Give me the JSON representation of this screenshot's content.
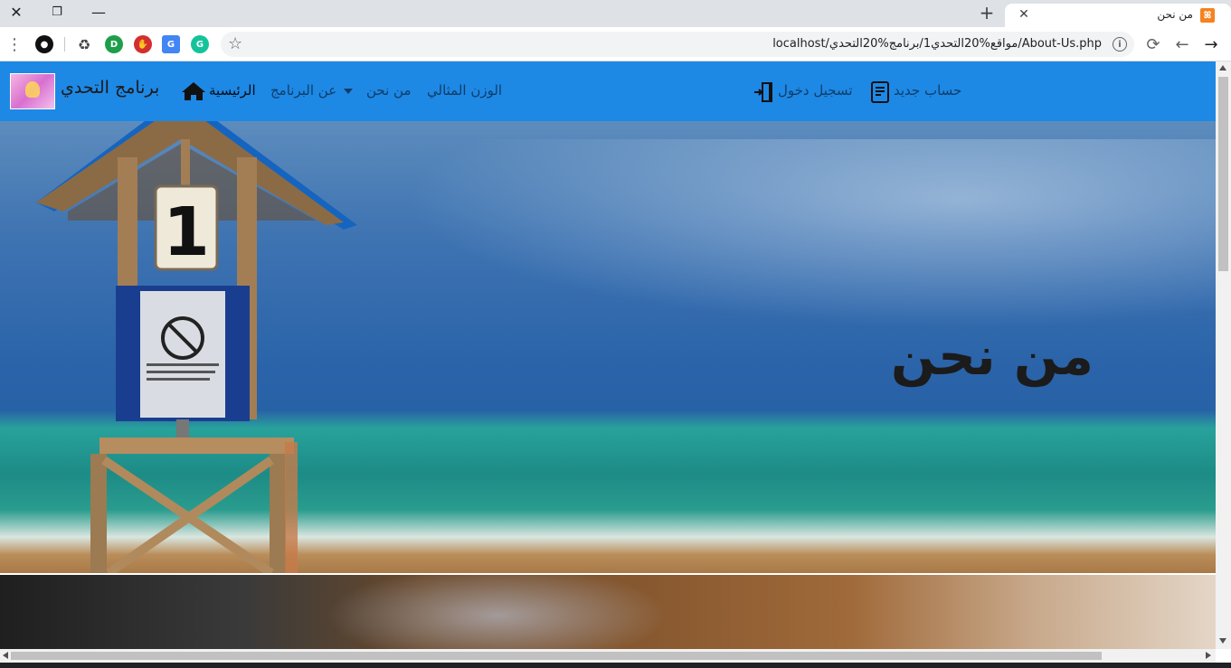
{
  "browser": {
    "tab_title": "من نحن",
    "url": "localhost/مواقع%20التحدي1/برنامج%20التحدي/About-Us.php",
    "colors": {
      "tabstrip": "#dee1e6",
      "accent": "#1e88e5"
    }
  },
  "navbar": {
    "brand": "برنامج التحدي",
    "home": "الرئيسية",
    "about_program": "عن البرنامج",
    "about_us": "من نحن",
    "ideal_weight": "الوزن المثالي",
    "login": "تسجيل دخول",
    "register": "حساب جديد"
  },
  "hero": {
    "title": "من نحن",
    "tower_number": "1"
  }
}
